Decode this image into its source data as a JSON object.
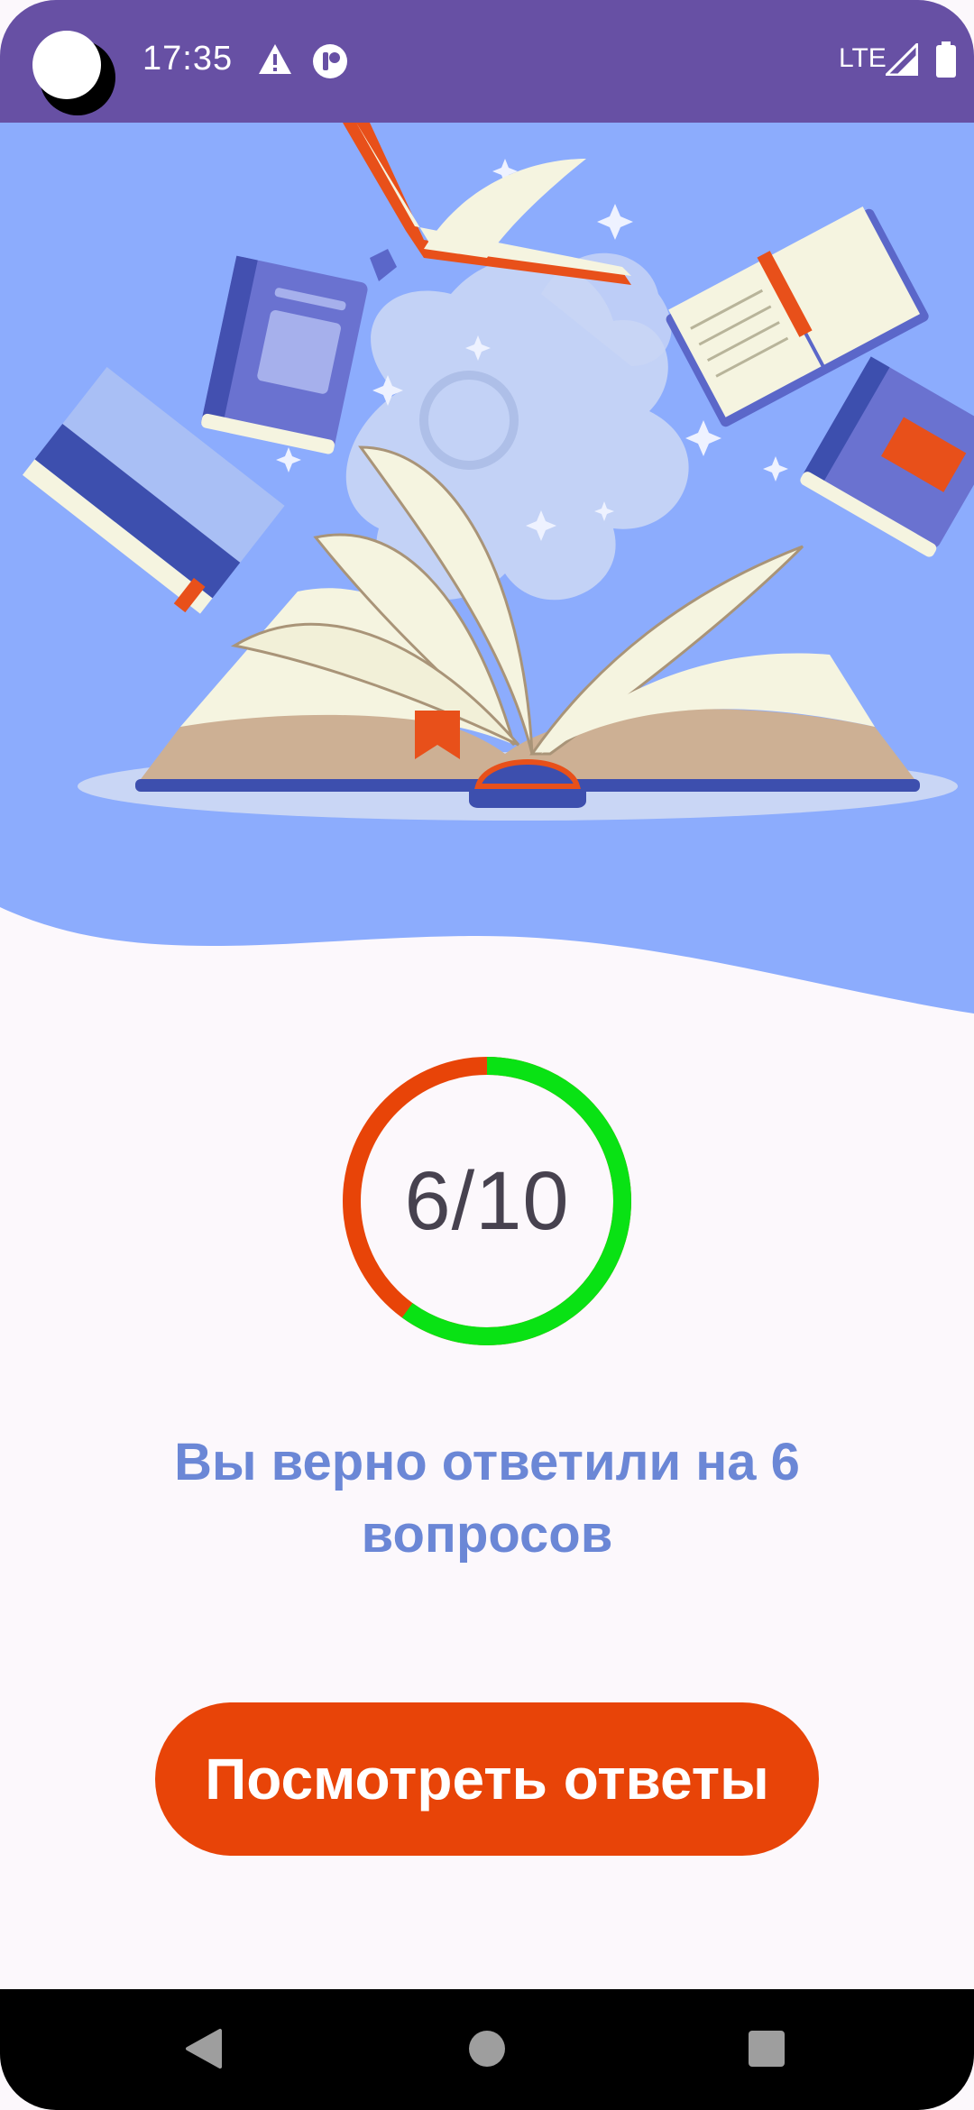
{
  "status_bar": {
    "time": "17:35",
    "network": "LTE",
    "icons": [
      "alert-icon",
      "app-notification-icon",
      "signal-icon",
      "battery-icon"
    ]
  },
  "result": {
    "score": "6/10",
    "correct": 6,
    "total": 10,
    "message": "Вы верно ответили на 6 вопросов",
    "colors": {
      "correct": "#09e214",
      "wrong": "#e84408"
    }
  },
  "actions": {
    "view_answers_label": "Посмотреть ответы"
  },
  "navigation": {
    "icons": [
      "back-icon",
      "home-icon",
      "recents-icon"
    ]
  }
}
